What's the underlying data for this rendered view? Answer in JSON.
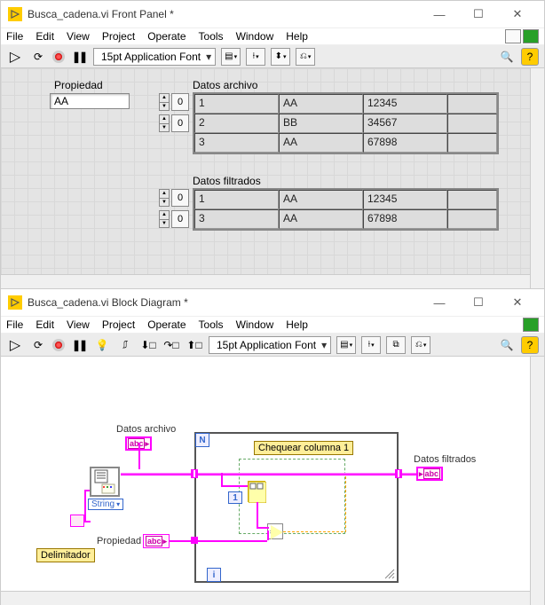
{
  "front_panel": {
    "title": "Busca_cadena.vi Front Panel *",
    "menu": {
      "file": "File",
      "edit": "Edit",
      "view": "View",
      "project": "Project",
      "operate": "Operate",
      "tools": "Tools",
      "window": "Window",
      "help": "Help"
    },
    "toolbar": {
      "font": "15pt Application Font"
    },
    "labels": {
      "propiedad": "Propiedad",
      "datos_archivo": "Datos archivo",
      "datos_filtrados": "Datos filtrados"
    },
    "controls": {
      "propiedad_value": "AA",
      "idx0": "0",
      "idx1": "0",
      "idx2": "0",
      "idx3": "0"
    },
    "tabla_archivo": [
      [
        "1",
        "AA",
        "12345"
      ],
      [
        "2",
        "BB",
        "34567"
      ],
      [
        "3",
        "AA",
        "67898"
      ]
    ],
    "tabla_filtrados": [
      [
        "1",
        "AA",
        "12345"
      ],
      [
        "3",
        "AA",
        "67898"
      ]
    ]
  },
  "block_diagram": {
    "title": "Busca_cadena.vi Block Diagram *",
    "menu": {
      "file": "File",
      "edit": "Edit",
      "view": "View",
      "project": "Project",
      "operate": "Operate",
      "tools": "Tools",
      "window": "Window",
      "help": "Help"
    },
    "toolbar": {
      "font": "15pt Application Font"
    },
    "labels": {
      "datos_archivo": "Datos archivo",
      "datos_filtrados": "Datos filtrados",
      "propiedad": "Propiedad",
      "delimitador": "Delimitador",
      "chequear": "Chequear columna 1",
      "string": "String",
      "const1": "1",
      "abc": "abc",
      "N": "N",
      "i": "i"
    }
  },
  "icons": {
    "run": "▷",
    "runcont": "⟳",
    "abort": "●",
    "pause": "❚❚",
    "bulb": "💡",
    "mag": "🔍",
    "help": "?",
    "caret": "▾",
    "min": "—",
    "max": "☐",
    "close": "✕"
  }
}
